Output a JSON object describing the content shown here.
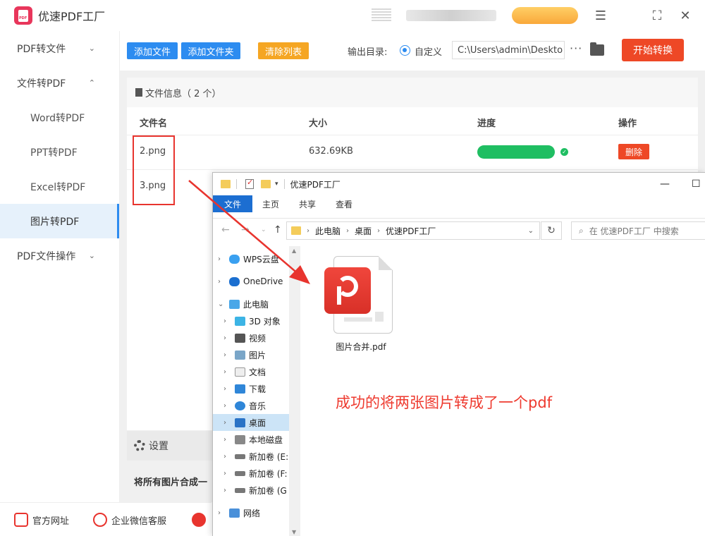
{
  "app": {
    "title": "优速PDF工厂",
    "accent": "#2d8cf0"
  },
  "window_controls": [
    "menu-icon",
    "maximize-icon",
    "close-icon"
  ],
  "sidebar": {
    "items": [
      {
        "label": "PDF转文件",
        "expanded": false
      },
      {
        "label": "文件转PDF",
        "expanded": true
      },
      {
        "label": "Word转PDF"
      },
      {
        "label": "PPT转PDF"
      },
      {
        "label": "Excel转PDF"
      },
      {
        "label": "图片转PDF",
        "active": true
      },
      {
        "label": "PDF文件操作",
        "expanded": false
      }
    ]
  },
  "toolbar": {
    "add_file": "添加文件",
    "add_folder": "添加文件夹",
    "clear_list": "清除列表",
    "output_label": "输出目录:",
    "radio_custom": "自定义",
    "output_path": "C:\\Users\\admin\\Deskto",
    "more": "···",
    "start": "开始转换"
  },
  "file_panel": {
    "header": "文件信息（ 2 个）",
    "columns": [
      "文件名",
      "大小",
      "进度",
      "操作"
    ],
    "rows": [
      {
        "name": "2.png",
        "size": "632.69KB",
        "progress": 1.0,
        "action": "删除"
      },
      {
        "name": "3.png"
      }
    ]
  },
  "settings": {
    "title": "设置",
    "option": "将所有图片合成一"
  },
  "footer": {
    "links": [
      "官方网址",
      "企业微信客服"
    ]
  },
  "explorer": {
    "title": "优速PDF工厂",
    "tabs": [
      "文件",
      "主页",
      "共享",
      "查看"
    ],
    "breadcrumb": [
      "此电脑",
      "桌面",
      "优速PDF工厂"
    ],
    "search_placeholder": "在 优速PDF工厂 中搜索",
    "nav": [
      {
        "label": "WPS云盘",
        "level": 0
      },
      {
        "label": "OneDrive",
        "level": 0
      },
      {
        "label": "此电脑",
        "level": 0,
        "expanded": true
      },
      {
        "label": "3D 对象",
        "level": 1
      },
      {
        "label": "视频",
        "level": 1
      },
      {
        "label": "图片",
        "level": 1
      },
      {
        "label": "文档",
        "level": 1
      },
      {
        "label": "下载",
        "level": 1
      },
      {
        "label": "音乐",
        "level": 1
      },
      {
        "label": "桌面",
        "level": 1,
        "selected": true
      },
      {
        "label": "本地磁盘",
        "level": 1
      },
      {
        "label": "新加卷 (E:",
        "level": 1
      },
      {
        "label": "新加卷 (F:",
        "level": 1
      },
      {
        "label": "新加卷 (G",
        "level": 1
      },
      {
        "label": "网络",
        "level": 0
      }
    ],
    "file": {
      "name": "图片合并.pdf"
    }
  },
  "annotation": {
    "text": "成功的将两张图片转成了一个pdf",
    "color": "#ee3a2f"
  }
}
